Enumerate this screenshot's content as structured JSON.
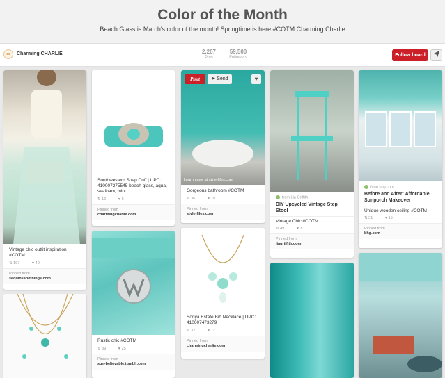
{
  "board": {
    "title": "Color of the Month",
    "description": "Beach Glass is March's color of the month! Springtime is here #COTM Charming Charlie"
  },
  "owner": {
    "avatar_text": "cc",
    "name": "Charming CHARLIE"
  },
  "stats": [
    {
      "num": "2,267",
      "label": "Pins"
    },
    {
      "num": "59,500",
      "label": "Followers"
    }
  ],
  "actions": {
    "follow": "Follow board",
    "send_icon": "paper-plane-icon"
  },
  "overlay": {
    "pinit": "Pinit",
    "send": "Send",
    "heart": "♥",
    "learn_more": "Learn more at style-files.com"
  },
  "pins": {
    "p1": {
      "desc": "Vintage chic outfit inspiration #COTM",
      "repins": "197",
      "likes": "40",
      "pinned_from": "Pinned from",
      "domain": "sequinsandthings.com"
    },
    "p2": {
      "desc": "Southwestern Snap Cuff | UPC: 410007275545 beach glass, aqua, seafoam, mint",
      "repins": "16",
      "likes": "6",
      "pinned_from": "Pinned from",
      "domain": "charmingcharlie.com"
    },
    "p3": {
      "desc": "Gorgeous bathroom #COTM",
      "repins": "36",
      "likes": "10",
      "pinned_from": "Pinned from",
      "domain": "style-files.com"
    },
    "p4": {
      "via": "from Lia Griffith",
      "title": "DIY Upcycled Vintage Step Stool",
      "sub": "Vintage Chic #COTM",
      "repins": "49",
      "likes": "3",
      "pinned_from": "Pinned from",
      "domain": "liagriffith.com"
    },
    "p5": {
      "via": "from bhg.com",
      "title": "Before and After: Affordable Sunporch Makeover",
      "sub": "Unique wooden ceiling #COTM",
      "repins": "31",
      "likes": "15",
      "pinned_from": "Pinned from",
      "domain": "bhg.com"
    },
    "p6": {
      "desc": "Rustic chic #COTM",
      "repins": "39",
      "likes": "25",
      "pinned_from": "Pinned from",
      "domain": "sun-believable.tumblr.com"
    },
    "p7": {
      "desc": "Sonya Estate Bib Necklace | UPC: 410007473279",
      "repins": "32",
      "likes": "12",
      "pinned_from": "Pinned from",
      "domain": "charmingcharlie.com"
    }
  },
  "colors": {
    "accent_red": "#cb2027",
    "beach_glass": "#6fd3c9"
  }
}
